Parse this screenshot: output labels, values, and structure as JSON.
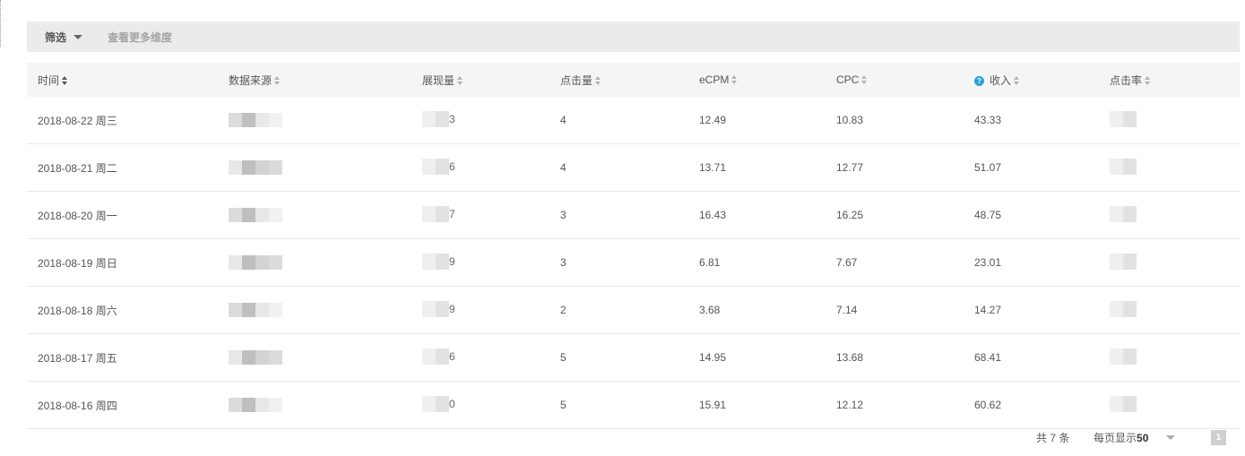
{
  "filter": {
    "label": "筛选",
    "more_label": "查看更多维度"
  },
  "table": {
    "columns": [
      "时间",
      "数据来源",
      "展现量",
      "点击量",
      "eCPM",
      "CPC",
      "收入",
      "点击率"
    ],
    "help_icon_glyph": "?",
    "rows": [
      {
        "date": "2018-08-22 周三",
        "impressions_visible": "3",
        "clicks": "4",
        "ecpm": "12.49",
        "cpc": "10.83",
        "revenue": "43.33"
      },
      {
        "date": "2018-08-21 周二",
        "impressions_visible": "6",
        "clicks": "4",
        "ecpm": "13.71",
        "cpc": "12.77",
        "revenue": "51.07"
      },
      {
        "date": "2018-08-20 周一",
        "impressions_visible": "7",
        "clicks": "3",
        "ecpm": "16.43",
        "cpc": "16.25",
        "revenue": "48.75"
      },
      {
        "date": "2018-08-19 周日",
        "impressions_visible": "9",
        "clicks": "3",
        "ecpm": "6.81",
        "cpc": "7.67",
        "revenue": "23.01"
      },
      {
        "date": "2018-08-18 周六",
        "impressions_visible": "9",
        "clicks": "2",
        "ecpm": "3.68",
        "cpc": "7.14",
        "revenue": "14.27"
      },
      {
        "date": "2018-08-17 周五",
        "impressions_visible": "6",
        "clicks": "5",
        "ecpm": "14.95",
        "cpc": "13.68",
        "revenue": "68.41"
      },
      {
        "date": "2018-08-16 周四",
        "impressions_visible": "0",
        "clicks": "5",
        "ecpm": "15.91",
        "cpc": "12.12",
        "revenue": "60.62"
      }
    ]
  },
  "pagination": {
    "total_text": "共 7 条",
    "page_size_label": "每页显示",
    "page_size_value": "50",
    "current_page": "1"
  },
  "colors": {
    "header_bg": "#f5f5f5",
    "filterbar_bg": "#ebebeb",
    "help_icon": "#29a3d6"
  }
}
